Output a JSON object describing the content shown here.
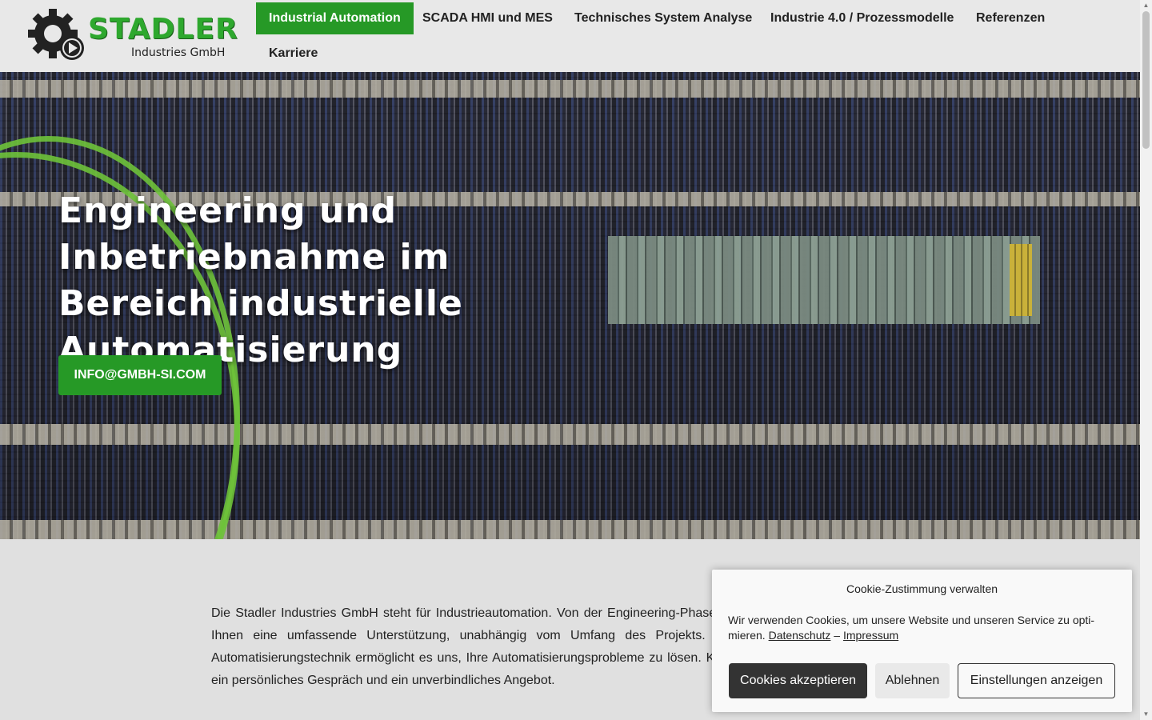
{
  "header": {
    "logo": {
      "title": "STADLER",
      "subtitle": "Industries GmbH"
    },
    "nav": [
      {
        "label": "Industrial Automation",
        "active": true
      },
      {
        "label": "SCADA HMI und MES",
        "active": false
      },
      {
        "label": "Technisches System Analyse",
        "active": false
      },
      {
        "label": "Industrie 4.0 / Prozessmodelle",
        "active": false
      },
      {
        "label": "Referenzen",
        "active": false
      },
      {
        "label": "Karriere",
        "active": false
      }
    ]
  },
  "hero": {
    "title": "Engineering und Inbetriebnahme im Bereich industrielle Automatisierung",
    "button_label": "INFO@GMBH-SI.COM"
  },
  "main": {
    "intro": "Die Stadler Industries GmbH steht für Industrieautomation. Von der Engineering-Phase bis zur Inbetriebnahme bieten wir Ihnen eine umfassende Unterstützung, unabhängig vom Umfang des Projekts. Unser breites Know-how in der Automatisierungstechnik ermöglicht es uns, Ihre Automatisierungsprobleme zu lösen. Kontaktieren Sie uns noch heute für ein persönliches Gespräch und ein unverbindliches Angebot."
  },
  "cookie": {
    "title": "Cookie-Zustimmung verwalten",
    "text": "Wir verwenden Cookies, um unsere Website und unseren Service zu opti­mieren.",
    "link_privacy": "Datenschutz",
    "separator": "–",
    "link_imprint": "Impressum",
    "accept_label": "Cookies akzeptieren",
    "deny_label": "Ablehnen",
    "settings_label": "Einstellungen anzeigen"
  },
  "colors": {
    "accent": "#269926",
    "logo_green": "#2ea82e",
    "cookie_dark": "#333333"
  },
  "icons": {
    "logo": "gear-play-icon"
  }
}
